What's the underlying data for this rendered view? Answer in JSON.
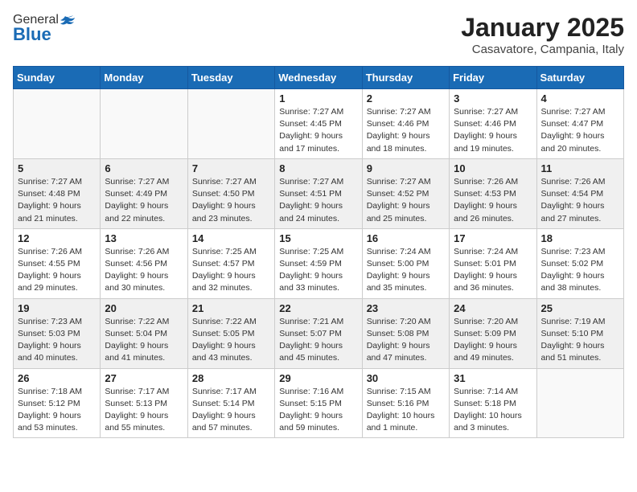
{
  "header": {
    "logo_general": "General",
    "logo_blue": "Blue",
    "month": "January 2025",
    "location": "Casavatore, Campania, Italy"
  },
  "weekdays": [
    "Sunday",
    "Monday",
    "Tuesday",
    "Wednesday",
    "Thursday",
    "Friday",
    "Saturday"
  ],
  "weeks": [
    {
      "shaded": false,
      "days": [
        {
          "date": "",
          "info": ""
        },
        {
          "date": "",
          "info": ""
        },
        {
          "date": "",
          "info": ""
        },
        {
          "date": "1",
          "info": "Sunrise: 7:27 AM\nSunset: 4:45 PM\nDaylight: 9 hours\nand 17 minutes."
        },
        {
          "date": "2",
          "info": "Sunrise: 7:27 AM\nSunset: 4:46 PM\nDaylight: 9 hours\nand 18 minutes."
        },
        {
          "date": "3",
          "info": "Sunrise: 7:27 AM\nSunset: 4:46 PM\nDaylight: 9 hours\nand 19 minutes."
        },
        {
          "date": "4",
          "info": "Sunrise: 7:27 AM\nSunset: 4:47 PM\nDaylight: 9 hours\nand 20 minutes."
        }
      ]
    },
    {
      "shaded": true,
      "days": [
        {
          "date": "5",
          "info": "Sunrise: 7:27 AM\nSunset: 4:48 PM\nDaylight: 9 hours\nand 21 minutes."
        },
        {
          "date": "6",
          "info": "Sunrise: 7:27 AM\nSunset: 4:49 PM\nDaylight: 9 hours\nand 22 minutes."
        },
        {
          "date": "7",
          "info": "Sunrise: 7:27 AM\nSunset: 4:50 PM\nDaylight: 9 hours\nand 23 minutes."
        },
        {
          "date": "8",
          "info": "Sunrise: 7:27 AM\nSunset: 4:51 PM\nDaylight: 9 hours\nand 24 minutes."
        },
        {
          "date": "9",
          "info": "Sunrise: 7:27 AM\nSunset: 4:52 PM\nDaylight: 9 hours\nand 25 minutes."
        },
        {
          "date": "10",
          "info": "Sunrise: 7:26 AM\nSunset: 4:53 PM\nDaylight: 9 hours\nand 26 minutes."
        },
        {
          "date": "11",
          "info": "Sunrise: 7:26 AM\nSunset: 4:54 PM\nDaylight: 9 hours\nand 27 minutes."
        }
      ]
    },
    {
      "shaded": false,
      "days": [
        {
          "date": "12",
          "info": "Sunrise: 7:26 AM\nSunset: 4:55 PM\nDaylight: 9 hours\nand 29 minutes."
        },
        {
          "date": "13",
          "info": "Sunrise: 7:26 AM\nSunset: 4:56 PM\nDaylight: 9 hours\nand 30 minutes."
        },
        {
          "date": "14",
          "info": "Sunrise: 7:25 AM\nSunset: 4:57 PM\nDaylight: 9 hours\nand 32 minutes."
        },
        {
          "date": "15",
          "info": "Sunrise: 7:25 AM\nSunset: 4:59 PM\nDaylight: 9 hours\nand 33 minutes."
        },
        {
          "date": "16",
          "info": "Sunrise: 7:24 AM\nSunset: 5:00 PM\nDaylight: 9 hours\nand 35 minutes."
        },
        {
          "date": "17",
          "info": "Sunrise: 7:24 AM\nSunset: 5:01 PM\nDaylight: 9 hours\nand 36 minutes."
        },
        {
          "date": "18",
          "info": "Sunrise: 7:23 AM\nSunset: 5:02 PM\nDaylight: 9 hours\nand 38 minutes."
        }
      ]
    },
    {
      "shaded": true,
      "days": [
        {
          "date": "19",
          "info": "Sunrise: 7:23 AM\nSunset: 5:03 PM\nDaylight: 9 hours\nand 40 minutes."
        },
        {
          "date": "20",
          "info": "Sunrise: 7:22 AM\nSunset: 5:04 PM\nDaylight: 9 hours\nand 41 minutes."
        },
        {
          "date": "21",
          "info": "Sunrise: 7:22 AM\nSunset: 5:05 PM\nDaylight: 9 hours\nand 43 minutes."
        },
        {
          "date": "22",
          "info": "Sunrise: 7:21 AM\nSunset: 5:07 PM\nDaylight: 9 hours\nand 45 minutes."
        },
        {
          "date": "23",
          "info": "Sunrise: 7:20 AM\nSunset: 5:08 PM\nDaylight: 9 hours\nand 47 minutes."
        },
        {
          "date": "24",
          "info": "Sunrise: 7:20 AM\nSunset: 5:09 PM\nDaylight: 9 hours\nand 49 minutes."
        },
        {
          "date": "25",
          "info": "Sunrise: 7:19 AM\nSunset: 5:10 PM\nDaylight: 9 hours\nand 51 minutes."
        }
      ]
    },
    {
      "shaded": false,
      "days": [
        {
          "date": "26",
          "info": "Sunrise: 7:18 AM\nSunset: 5:12 PM\nDaylight: 9 hours\nand 53 minutes."
        },
        {
          "date": "27",
          "info": "Sunrise: 7:17 AM\nSunset: 5:13 PM\nDaylight: 9 hours\nand 55 minutes."
        },
        {
          "date": "28",
          "info": "Sunrise: 7:17 AM\nSunset: 5:14 PM\nDaylight: 9 hours\nand 57 minutes."
        },
        {
          "date": "29",
          "info": "Sunrise: 7:16 AM\nSunset: 5:15 PM\nDaylight: 9 hours\nand 59 minutes."
        },
        {
          "date": "30",
          "info": "Sunrise: 7:15 AM\nSunset: 5:16 PM\nDaylight: 10 hours\nand 1 minute."
        },
        {
          "date": "31",
          "info": "Sunrise: 7:14 AM\nSunset: 5:18 PM\nDaylight: 10 hours\nand 3 minutes."
        },
        {
          "date": "",
          "info": ""
        }
      ]
    }
  ]
}
